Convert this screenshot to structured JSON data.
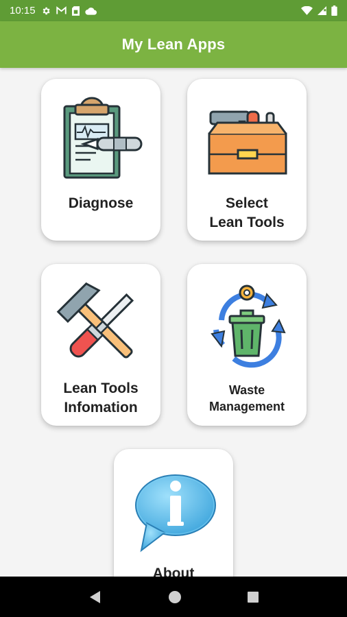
{
  "status_bar": {
    "time": "10:15",
    "left_icons": [
      "gear-icon",
      "gmail-icon",
      "sim-card-icon",
      "cloud-icon"
    ],
    "right_icons": [
      "wifi-icon",
      "signal-icon",
      "battery-icon"
    ]
  },
  "app_bar": {
    "title": "My Lean Apps",
    "color": "#7cb342"
  },
  "menu": {
    "diagnose": {
      "label": "Diagnose",
      "icon": "clipboard-pen-icon"
    },
    "select_tools": {
      "label": "Select\nLean Tools",
      "icon": "toolbox-icon"
    },
    "tools_info": {
      "label": "Lean Tools\nInfomation",
      "icon": "screwdriver-hammer-icon"
    },
    "waste": {
      "label": "Waste\nManagement",
      "icon": "recycle-bin-icon"
    },
    "about": {
      "label": "About",
      "icon": "info-bubble-icon"
    }
  },
  "nav_bar": {
    "buttons": [
      "back-button",
      "home-button",
      "recents-button"
    ]
  }
}
